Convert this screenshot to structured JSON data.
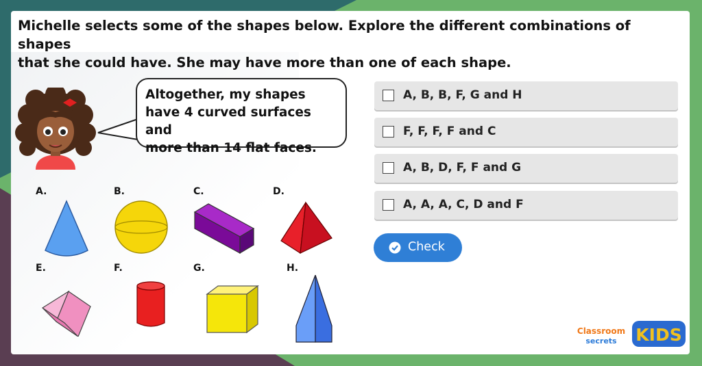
{
  "question": {
    "line1": "Michelle selects some of the shapes below. Explore the different combinations of shapes",
    "line2": "that she could have. She may have more than one of each shape."
  },
  "speech": {
    "line1": "Altogether, my shapes",
    "line2": "have 4 curved surfaces and",
    "line3": "more than 14 flat faces."
  },
  "shapes": [
    {
      "label": "A.",
      "icon": "cone-icon",
      "color": "#5aa0f0"
    },
    {
      "label": "B.",
      "icon": "sphere-icon",
      "color": "#f5d60a"
    },
    {
      "label": "C.",
      "icon": "cuboid-icon",
      "color": "#8a0aa8"
    },
    {
      "label": "D.",
      "icon": "square-pyramid-icon",
      "color": "#e8202a"
    },
    {
      "label": "E.",
      "icon": "triangular-prism-icon",
      "color": "#f5a0c8"
    },
    {
      "label": "F.",
      "icon": "cylinder-icon",
      "color": "#e82020"
    },
    {
      "label": "G.",
      "icon": "cube-icon",
      "color": "#f5e60a"
    },
    {
      "label": "H.",
      "icon": "tall-pyramid-icon",
      "color": "#5a8ef0"
    }
  ],
  "options": [
    {
      "label": "A, B, B, F, G and H",
      "checked": false
    },
    {
      "label": "F, F, F, F and C",
      "checked": false
    },
    {
      "label": "A, B, D, F, F and G",
      "checked": false
    },
    {
      "label": "A, A, A, C, D and F",
      "checked": false
    }
  ],
  "check_button": {
    "label": "Check",
    "icon": "check-circle-icon",
    "color": "#2f7fd6"
  },
  "logos": {
    "classroom": "Classroom",
    "secrets": "secrets",
    "kids": "KIDS"
  }
}
